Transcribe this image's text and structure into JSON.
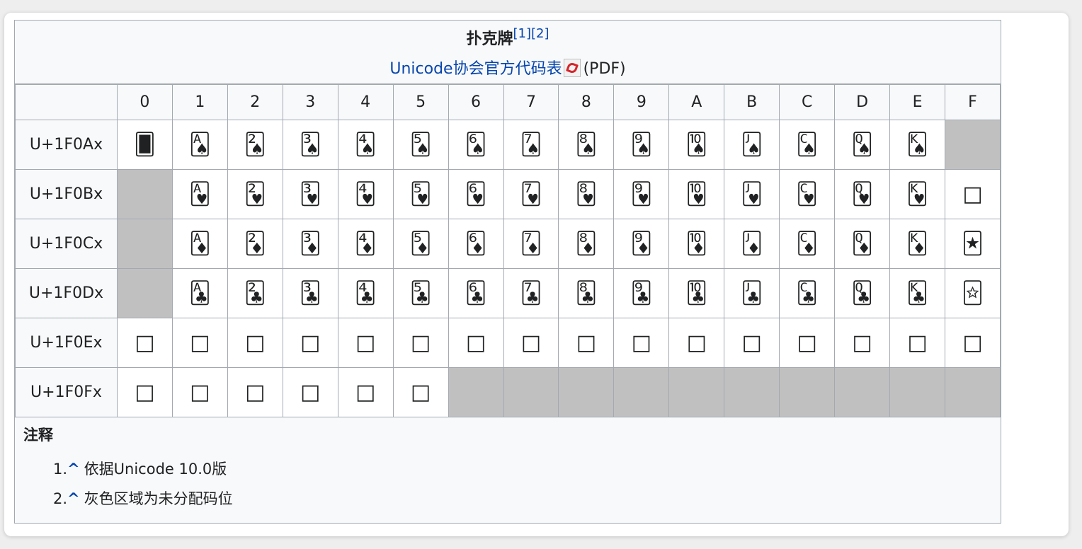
{
  "table": {
    "title": "扑克牌",
    "title_refs": [
      "[1]",
      "[2]"
    ],
    "chart_link": "Unicode协会官方代码表",
    "chart_format": "(PDF)",
    "pdf_icon": "pdf-icon",
    "corner": "",
    "columns": [
      "0",
      "1",
      "2",
      "3",
      "4",
      "5",
      "6",
      "7",
      "8",
      "9",
      "A",
      "B",
      "C",
      "D",
      "E",
      "F"
    ],
    "rows": [
      {
        "label": "U+1F0Ax",
        "cells": [
          "🂠",
          "🂡",
          "🂢",
          "🂣",
          "🂤",
          "🂥",
          "🂦",
          "🂧",
          "🂨",
          "🂩",
          "🂪",
          "🂫",
          "🂬",
          "🂭",
          "🂮",
          null
        ]
      },
      {
        "label": "U+1F0Bx",
        "cells": [
          null,
          "🂱",
          "🂲",
          "🂳",
          "🂴",
          "🂵",
          "🂶",
          "🂷",
          "🂸",
          "🂹",
          "🂺",
          "🂻",
          "🂼",
          "🂽",
          "🂾",
          "□"
        ]
      },
      {
        "label": "U+1F0Cx",
        "cells": [
          null,
          "🃁",
          "🃂",
          "🃃",
          "🃄",
          "🃅",
          "🃆",
          "🃇",
          "🃈",
          "🃉",
          "🃊",
          "🃋",
          "🃌",
          "🃍",
          "🃎",
          "🃏"
        ]
      },
      {
        "label": "U+1F0Dx",
        "cells": [
          null,
          "🃑",
          "🃒",
          "🃓",
          "🃔",
          "🃕",
          "🃖",
          "🃗",
          "🃘",
          "🃙",
          "🃚",
          "🃛",
          "🃜",
          "🃝",
          "🃞",
          "🃟"
        ]
      },
      {
        "label": "U+1F0Ex",
        "cells": [
          "□",
          "□",
          "□",
          "□",
          "□",
          "□",
          "□",
          "□",
          "□",
          "□",
          "□",
          "□",
          "□",
          "□",
          "□",
          "□"
        ]
      },
      {
        "label": "U+1F0Fx",
        "cells": [
          "□",
          "□",
          "□",
          "□",
          "□",
          "□",
          null,
          null,
          null,
          null,
          null,
          null,
          null,
          null,
          null,
          null
        ]
      }
    ],
    "colors": {
      "unassigned": "#c0c0c0",
      "link": "#0645ad",
      "border": "#a2a9b1",
      "header_bg": "#f8f9fa"
    }
  },
  "notes": {
    "title": "注释",
    "items": [
      {
        "num": "1.",
        "caret": "^",
        "text": "依据Unicode 10.0版"
      },
      {
        "num": "2.",
        "caret": "^",
        "text": "灰色区域为未分配码位"
      }
    ]
  }
}
